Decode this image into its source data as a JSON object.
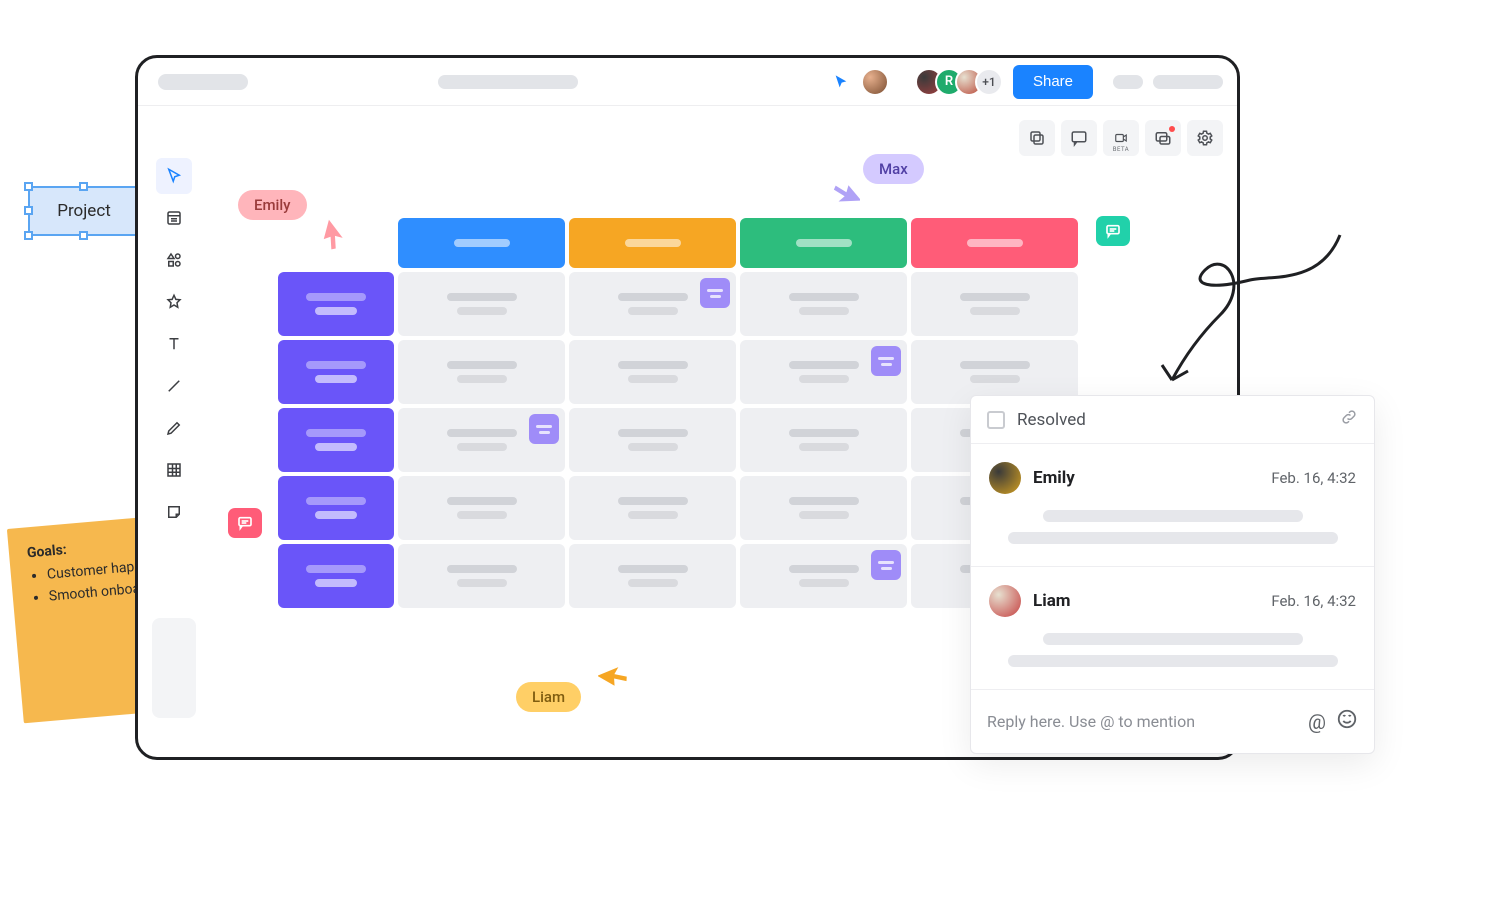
{
  "project_shape_label": "Project",
  "topbar": {
    "avatars_extra": "+1",
    "avatar_letter": "R",
    "share_label": "Share"
  },
  "users": {
    "emily": "Emily",
    "max": "Max",
    "liam": "Liam"
  },
  "sticky": {
    "title": "Goals:",
    "item1": "Customer happiness",
    "item2": "Smooth onboarding"
  },
  "subtoolbar": {
    "beta_label": "BETA"
  },
  "comments": {
    "resolved_label": "Resolved",
    "reply_placeholder": "Reply here. Use @ to mention",
    "mention_symbol": "@",
    "items": [
      {
        "name": "Emily",
        "time": "Feb. 16, 4:32"
      },
      {
        "name": "Liam",
        "time": "Feb. 16, 4:32"
      }
    ]
  }
}
